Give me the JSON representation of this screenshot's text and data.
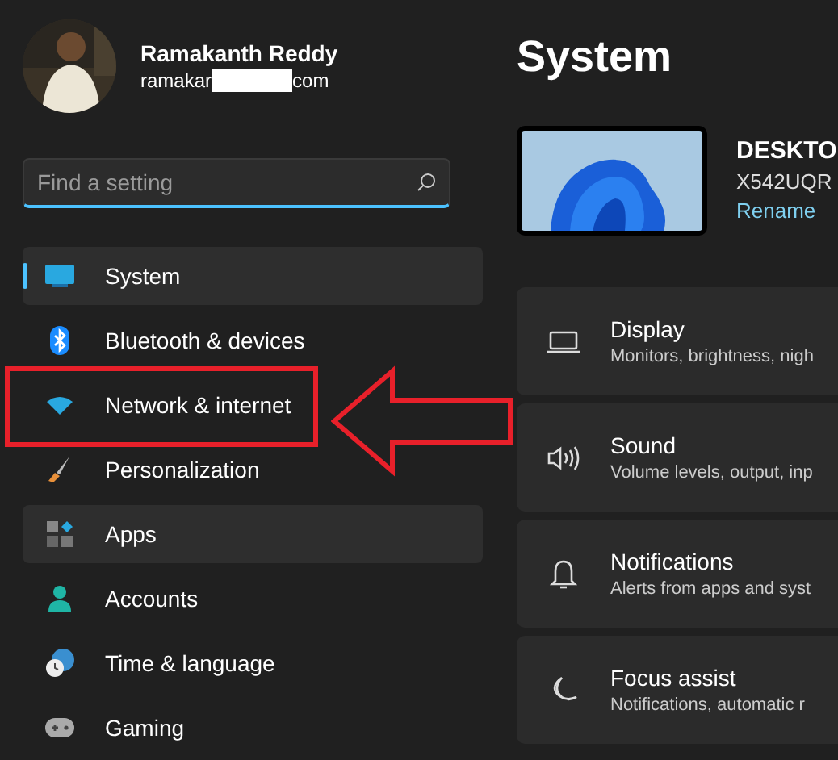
{
  "account": {
    "name": "Ramakanth Reddy",
    "email_start": "ramakar",
    "email_end": "com",
    "email_redacted": true
  },
  "search": {
    "placeholder": "Find a setting"
  },
  "sidebar": {
    "items": [
      {
        "label": "System",
        "kind": "system",
        "selected": true,
        "highlighted": true,
        "annotated": false
      },
      {
        "label": "Bluetooth & devices",
        "kind": "bluetooth",
        "selected": false,
        "highlighted": false,
        "annotated": false
      },
      {
        "label": "Network & internet",
        "kind": "wifi",
        "selected": false,
        "highlighted": false,
        "annotated": true
      },
      {
        "label": "Personalization",
        "kind": "brush",
        "selected": false,
        "highlighted": false,
        "annotated": false
      },
      {
        "label": "Apps",
        "kind": "apps",
        "selected": false,
        "highlighted": true,
        "annotated": false
      },
      {
        "label": "Accounts",
        "kind": "person",
        "selected": false,
        "highlighted": false,
        "annotated": false
      },
      {
        "label": "Time & language",
        "kind": "clock",
        "selected": false,
        "highlighted": false,
        "annotated": false
      },
      {
        "label": "Gaming",
        "kind": "gamepad",
        "selected": false,
        "highlighted": false,
        "annotated": false
      }
    ]
  },
  "page": {
    "title": "System"
  },
  "device": {
    "name": "DESKTO",
    "model": "X542UQR",
    "rename": "Rename"
  },
  "settings": [
    {
      "kind": "laptop",
      "title": "Display",
      "subtitle": "Monitors, brightness, nigh"
    },
    {
      "kind": "speaker",
      "title": "Sound",
      "subtitle": "Volume levels, output, inp"
    },
    {
      "kind": "bell",
      "title": "Notifications",
      "subtitle": "Alerts from apps and syst"
    },
    {
      "kind": "moon",
      "title": "Focus assist",
      "subtitle": "Notifications, automatic r"
    }
  ]
}
